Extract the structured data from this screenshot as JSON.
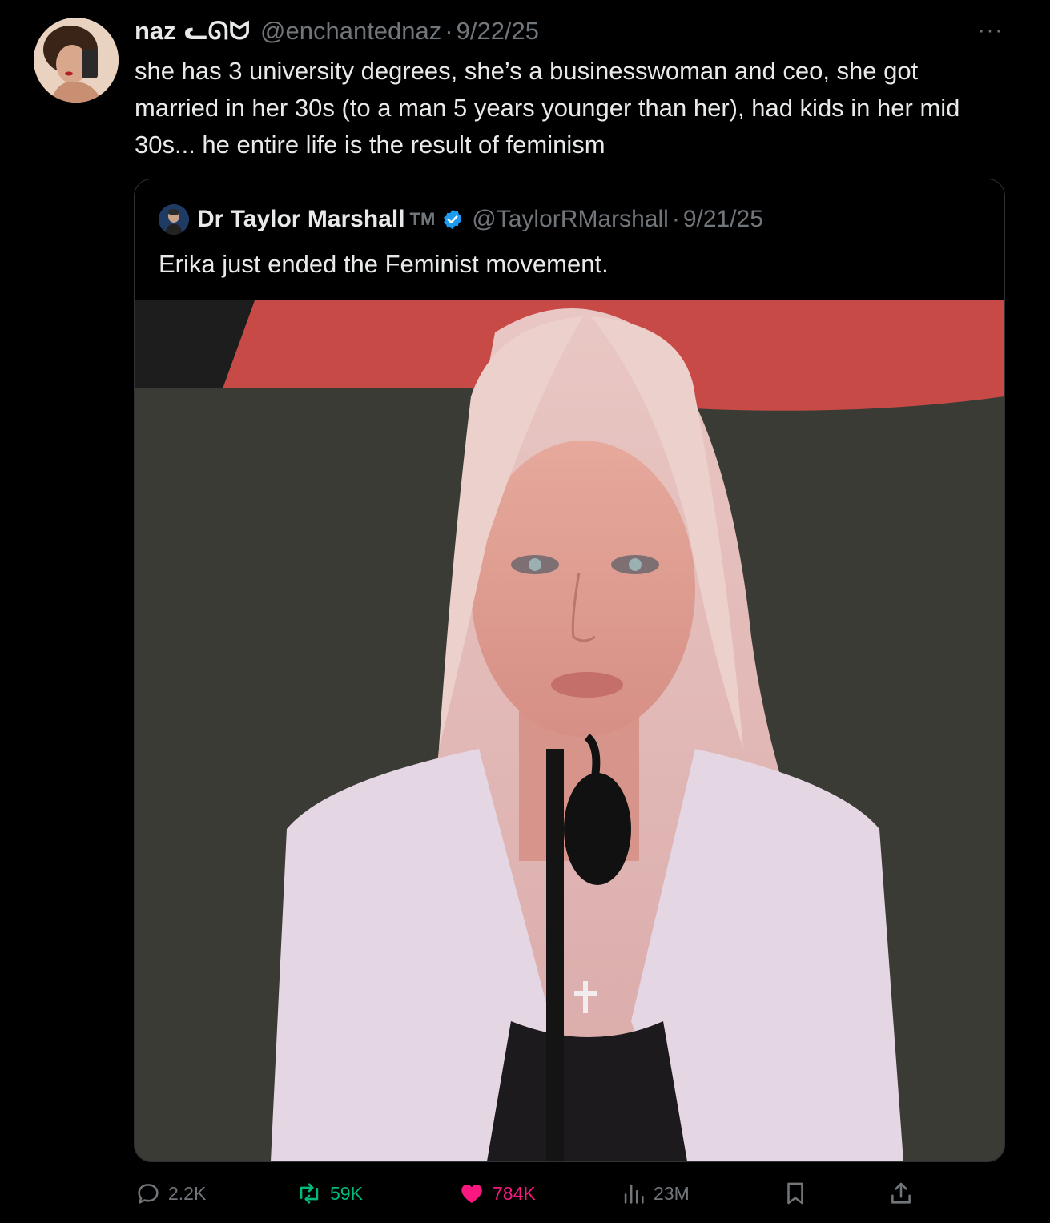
{
  "tweet": {
    "author_name": "naz",
    "author_name_glyphs": "ᓚᘏᗢ",
    "handle": "@enchantednaz",
    "separator": "·",
    "date": "9/22/25",
    "more_label": "···",
    "text": "she has 3 university degrees, she’s a businesswoman and ceo, she got married in her 30s (to a man 5 years younger than her), had kids in her mid 30s... he entire life is the result of feminism"
  },
  "quote": {
    "author_name": "Dr Taylor Marshall",
    "tm_mark": "TM",
    "handle": "@TaylorRMarshall",
    "separator": "·",
    "date": "9/21/25",
    "text": "Erika just ended the Feminist movement.",
    "verified_color": "#1d9bf0"
  },
  "actions": {
    "replies": "2.2K",
    "retweets": "59K",
    "likes": "784K",
    "views": "23M"
  },
  "colors": {
    "background": "#000000",
    "text_primary": "#e7e9ea",
    "text_secondary": "#71767b",
    "retweet_green": "#00ba7c",
    "like_pink": "#f91880",
    "border": "#2f3336"
  },
  "icons": [
    "reply-icon",
    "retweet-icon",
    "like-icon",
    "views-icon",
    "bookmark-icon",
    "share-icon",
    "verified-badge-icon"
  ]
}
